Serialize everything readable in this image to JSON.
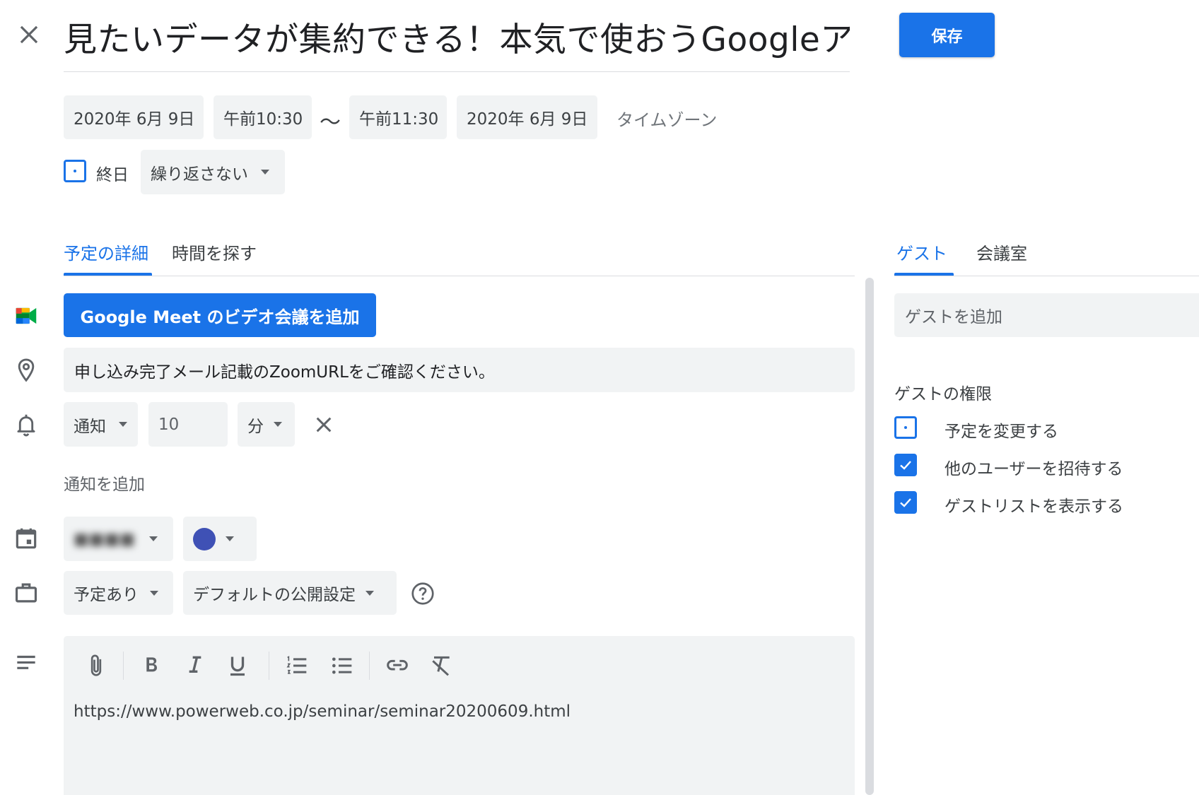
{
  "header": {
    "title": "見たいデータが集約できる！本気で使おうGoogleア",
    "save_label": "保存"
  },
  "datetime": {
    "start_date": "2020年 6月 9日",
    "start_time": "午前10:30",
    "separator": "〜",
    "end_time": "午前11:30",
    "end_date": "2020年 6月 9日",
    "timezone_label": "タイムゾーン",
    "all_day_label": "終日",
    "all_day_checked": false,
    "repeat_label": "繰り返さない"
  },
  "left_tabs": [
    {
      "label": "予定の詳細",
      "active": true
    },
    {
      "label": "時間を探す",
      "active": false
    }
  ],
  "details": {
    "meet_button_label": "Google Meet のビデオ会議を追加",
    "location_value": "申し込み完了メール記載のZoomURLをご確認ください。",
    "notification": {
      "type_label": "通知",
      "value": "10",
      "unit_label": "分"
    },
    "add_notification_label": "通知を追加",
    "calendar_name": "■■■■",
    "event_color": "#3f51b5",
    "busy_label": "予定あり",
    "visibility_label": "デフォルトの公開設定",
    "description_text": "https://www.powerweb.co.jp/seminar/seminar20200609.html"
  },
  "right_tabs": [
    {
      "label": "ゲスト",
      "active": true
    },
    {
      "label": "会議室",
      "active": false
    }
  ],
  "guests": {
    "add_placeholder": "ゲストを追加",
    "permissions_title": "ゲストの権限",
    "permissions": [
      {
        "label": "予定を変更する",
        "checked": false
      },
      {
        "label": "他のユーザーを招待する",
        "checked": true
      },
      {
        "label": "ゲストリストを表示する",
        "checked": true
      }
    ]
  },
  "colors": {
    "accent": "#1a73e8",
    "chip_bg": "#f1f3f4"
  }
}
